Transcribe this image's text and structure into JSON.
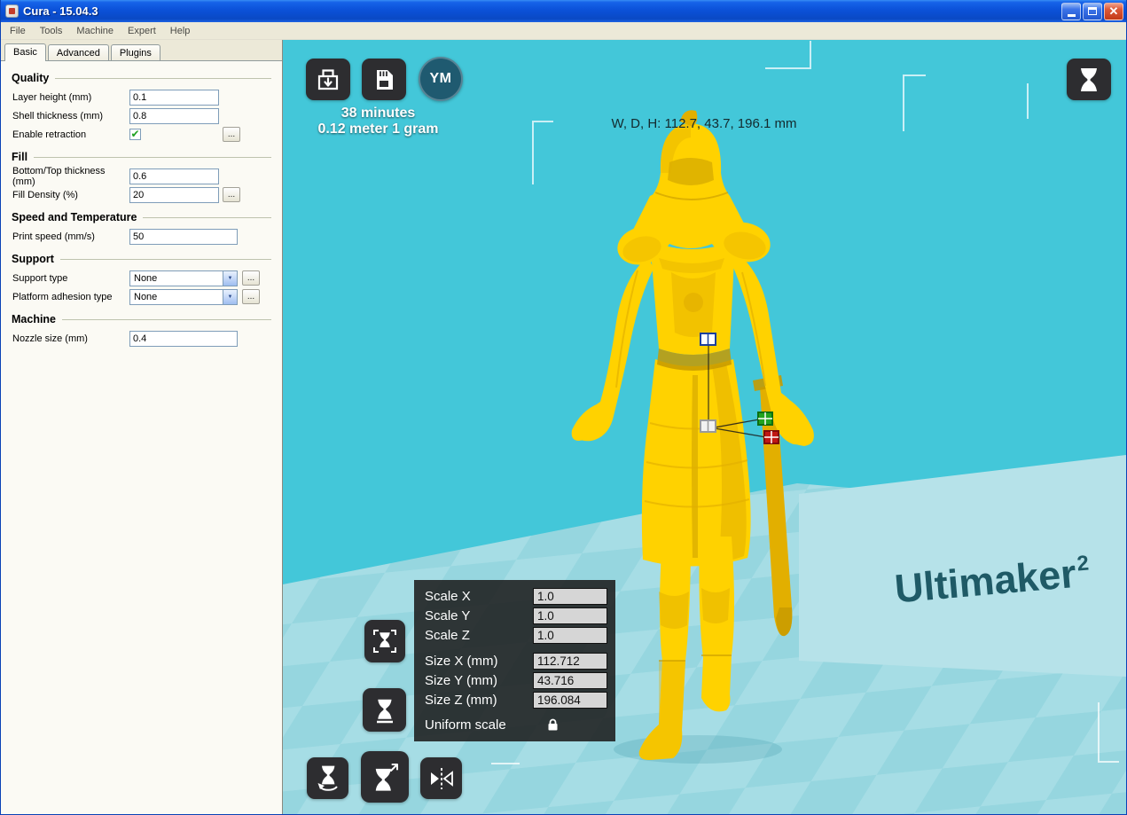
{
  "window": {
    "title": "Cura - 15.04.3"
  },
  "icons": {
    "chevron_down": "▼",
    "check": "✔",
    "close": "✕"
  },
  "menu": {
    "items": [
      "File",
      "Tools",
      "Machine",
      "Expert",
      "Help"
    ]
  },
  "panel": {
    "tabs": [
      {
        "label": "Basic",
        "active": true
      },
      {
        "label": "Advanced",
        "active": false
      },
      {
        "label": "Plugins",
        "active": false
      }
    ],
    "more_label": "...",
    "sections": [
      {
        "title": "Quality",
        "fields": [
          {
            "label": "Layer height (mm)",
            "type": "text",
            "value": "0.1"
          },
          {
            "label": "Shell thickness (mm)",
            "type": "text",
            "value": "0.8"
          },
          {
            "label": "Enable retraction",
            "type": "checkbox",
            "checked": true,
            "more": true
          }
        ]
      },
      {
        "title": "Fill",
        "fields": [
          {
            "label": "Bottom/Top thickness (mm)",
            "type": "text",
            "value": "0.6"
          },
          {
            "label": "Fill Density (%)",
            "type": "text",
            "value": "20",
            "more": true
          }
        ]
      },
      {
        "title": "Speed and Temperature",
        "fields": [
          {
            "label": "Print speed (mm/s)",
            "type": "text",
            "value": "50",
            "wide": true
          }
        ]
      },
      {
        "title": "Support",
        "fields": [
          {
            "label": "Support type",
            "type": "select",
            "value": "None",
            "more": true
          },
          {
            "label": "Platform adhesion type",
            "type": "select",
            "value": "None",
            "more": true
          }
        ]
      },
      {
        "title": "Machine",
        "fields": [
          {
            "label": "Nozzle size (mm)",
            "type": "text",
            "value": "0.4",
            "wide": true
          }
        ]
      }
    ]
  },
  "viewport": {
    "print_time": "38 minutes",
    "print_material": "0.12 meter 1 gram",
    "dimensions": "W, D, H: 112.7, 43.7, 196.1 mm",
    "youmagine_label": "YM",
    "branding": {
      "name": "Ultimaker",
      "sup": "2"
    },
    "scale_panel": {
      "rows": [
        {
          "label": "Scale X",
          "value": "1.0"
        },
        {
          "label": "Scale Y",
          "value": "1.0"
        },
        {
          "label": "Scale Z",
          "value": "1.0"
        },
        {
          "label": "Size X (mm)",
          "value": "112.712"
        },
        {
          "label": "Size Y (mm)",
          "value": "43.716"
        },
        {
          "label": "Size Z (mm)",
          "value": "196.084"
        }
      ],
      "uniform_label": "Uniform scale"
    }
  },
  "colors": {
    "menubar-bg": "#ECE9D8",
    "panel-bg": "#FBFAF4",
    "viewport-bg": "#43C7D9",
    "plate-light": "#A6DDE5",
    "plate-dark": "#96D6DF",
    "wall-panel": "#B6E2E9",
    "brand-text": "#1F5A66",
    "model-yellow": "#FFD200",
    "model-shade": "#E2AF00",
    "model-deep": "#C79A00",
    "check-green": "#21A121",
    "ym-circle": "#1F5A70"
  }
}
